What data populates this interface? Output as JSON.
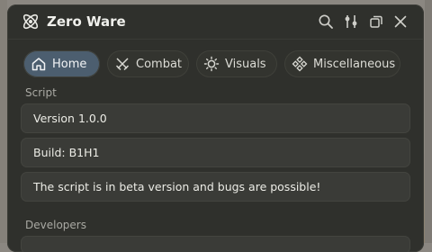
{
  "window": {
    "title": "Zero Ware"
  },
  "titlebar_icons": [
    "search-icon",
    "sliders-icon",
    "restore-icon",
    "close-icon"
  ],
  "tabs": [
    {
      "label": "Home",
      "icon": "home-icon",
      "active": true
    },
    {
      "label": "Combat",
      "icon": "swords-icon",
      "active": false
    },
    {
      "label": "Visuals",
      "icon": "sun-icon",
      "active": false
    },
    {
      "label": "Miscellaneous",
      "icon": "diamond-grid-icon",
      "active": false
    }
  ],
  "sections": {
    "script": {
      "label": "Script",
      "cards": [
        "Version 1.0.0",
        "Build: B1H1",
        "The script is in beta version and bugs are possible!"
      ]
    },
    "developers": {
      "label": "Developers"
    }
  },
  "colors": {
    "panel": "#2f302c",
    "card": "#3a3b37",
    "active_tab": "#4c5e6f",
    "text": "#ececE6"
  }
}
